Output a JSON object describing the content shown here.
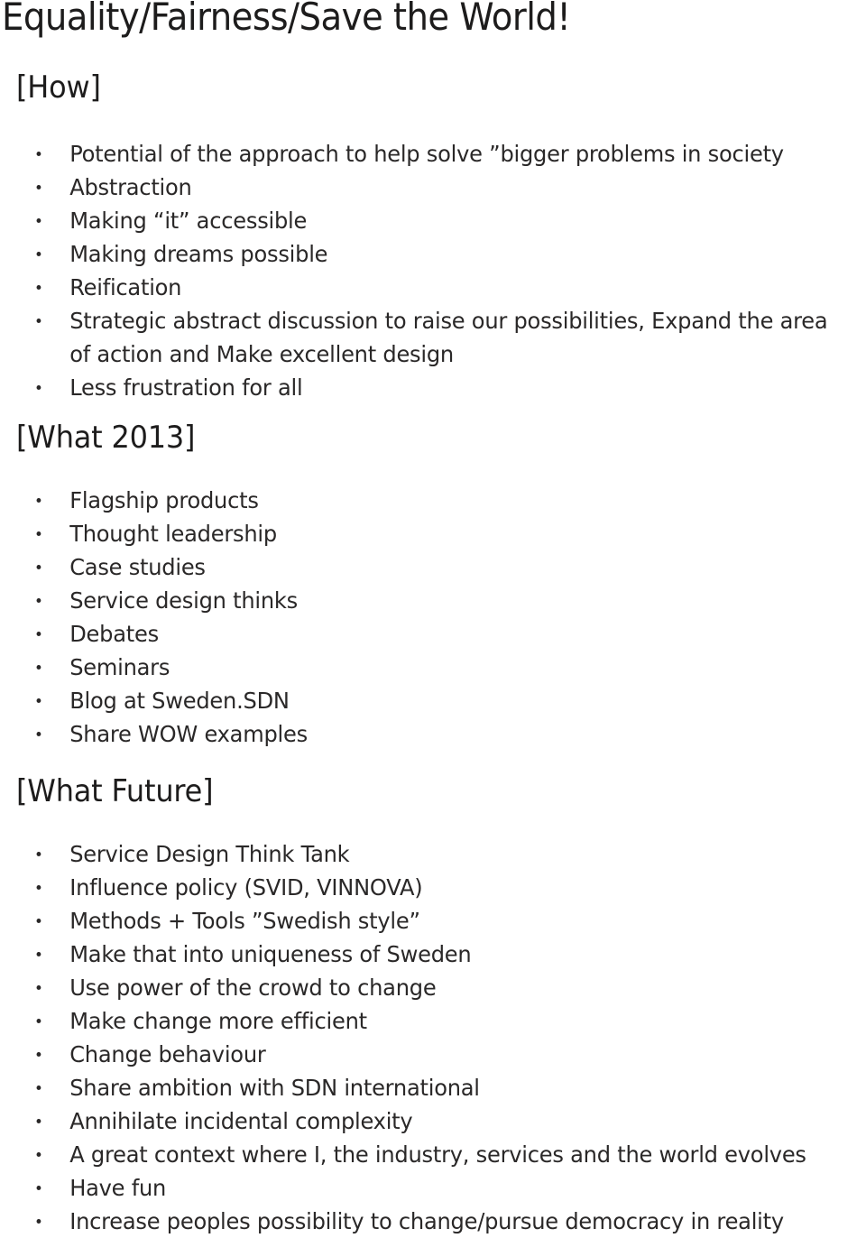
{
  "document": {
    "title": "Equality/Fairness/Save the World!",
    "sections": [
      {
        "heading": "[How]",
        "bullets": [
          "Potential of the approach to help solve ”bigger problems in society",
          "Abstraction",
          "Making “it” accessible",
          "Making dreams possible",
          "Reification",
          "Strategic abstract discussion to raise our possibilities, Expand the area of action and Make excellent design",
          "Less frustration for all"
        ]
      },
      {
        "heading": "[What 2013]",
        "bullets": [
          "Flagship products",
          "Thought leadership",
          "Case studies",
          "Service design thinks",
          "Debates",
          "Seminars",
          "Blog at Sweden.SDN",
          "Share WOW examples"
        ]
      },
      {
        "heading": "[What Future]",
        "bullets": [
          "Service Design Think Tank",
          "Influence policy (SVID, VINNOVA)",
          "Methods + Tools ”Swedish style”",
          "Make that into uniqueness of Sweden",
          "Use power of the crowd to change",
          "Make change more efficient",
          "Change behaviour",
          "Share ambition with SDN international",
          "Annihilate incidental complexity",
          "A great context where I, the industry, services and the world evolves",
          "Have fun",
          "Increase peoples possibility to change/pursue democracy in reality"
        ]
      }
    ]
  }
}
